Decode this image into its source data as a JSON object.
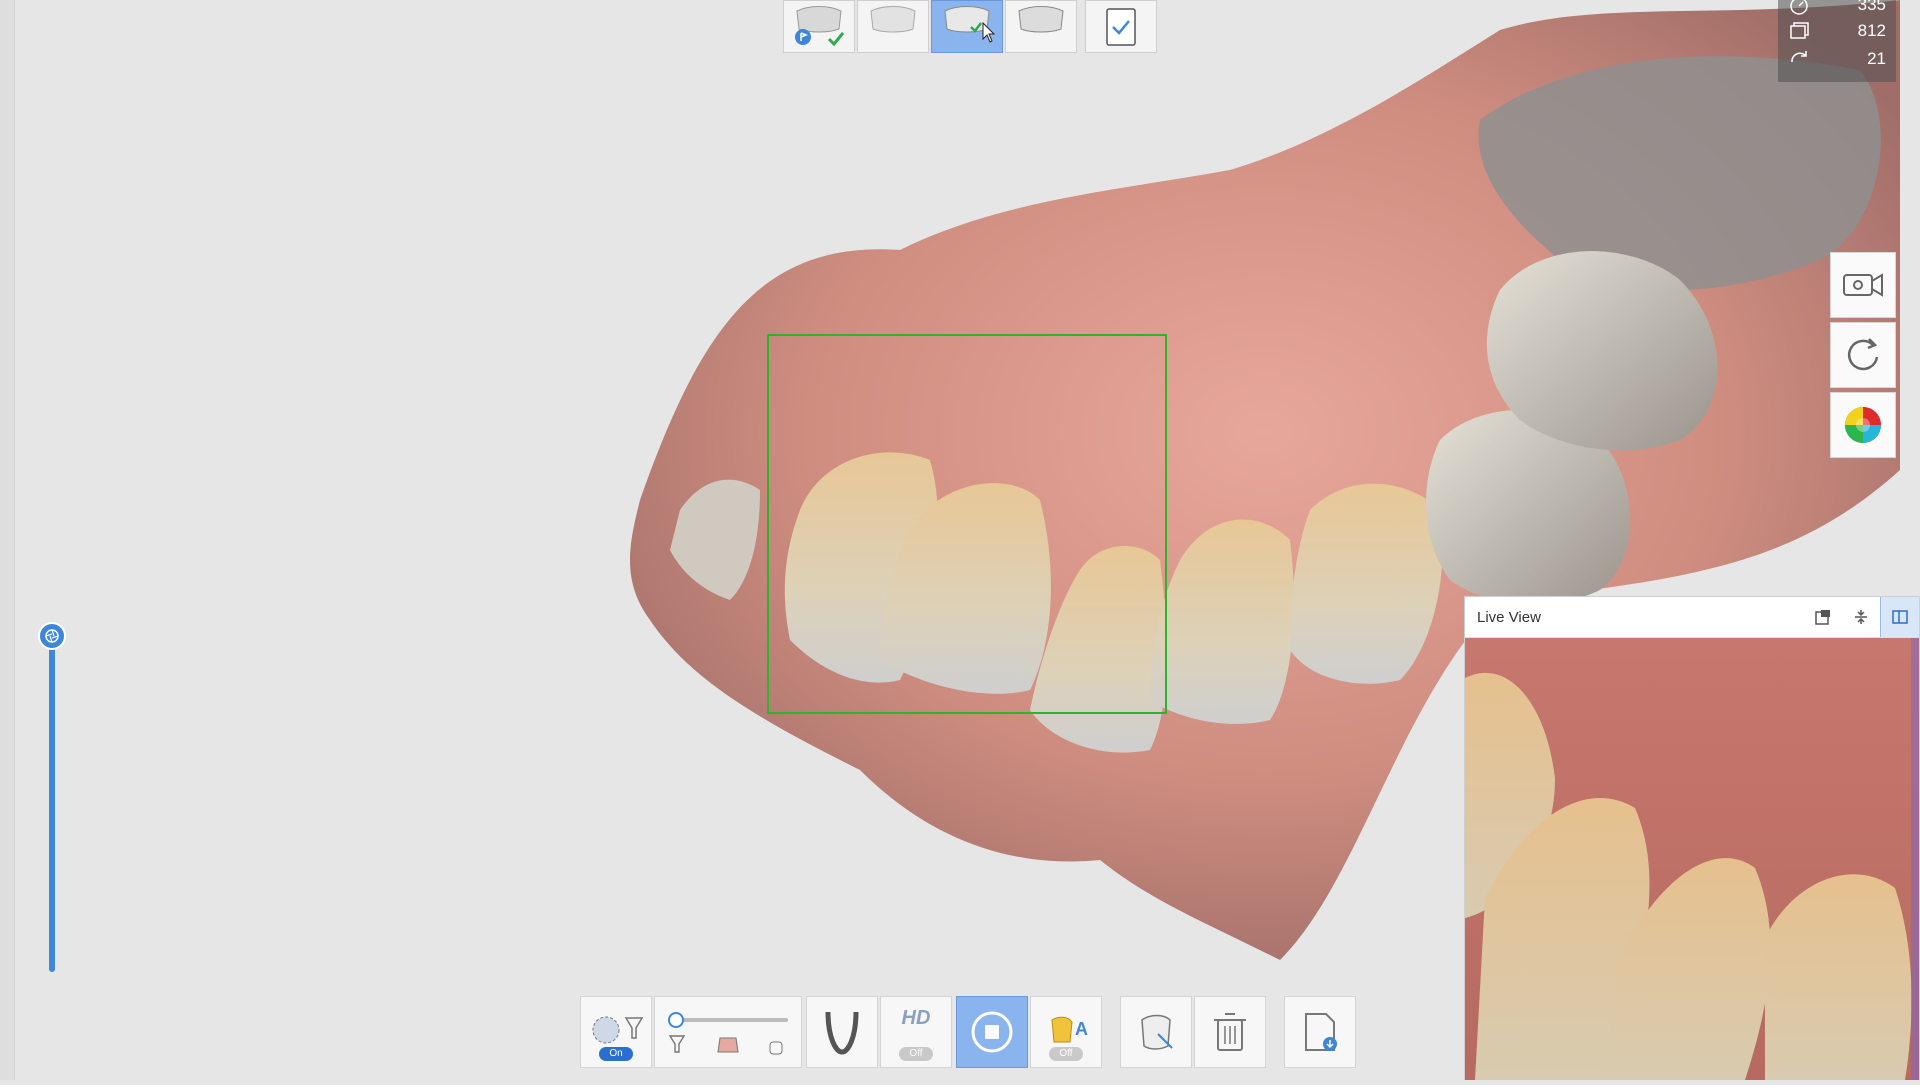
{
  "stats": [
    {
      "icon": "timer-icon",
      "value": "335"
    },
    {
      "icon": "frames-icon",
      "value": "812"
    },
    {
      "icon": "rotation-icon",
      "value": "21"
    }
  ],
  "live_view": {
    "title": "Live View"
  },
  "toolbar": {
    "hd_label": "HD",
    "ai_label": "A",
    "filter_toggle": "On",
    "hd_toggle": "Off",
    "ai_toggle": "Off"
  },
  "colors": {
    "accent": "#3d86d8",
    "active_step": "#8ab4ee",
    "scan_box": "#2bb52b",
    "check": "#2fa84f"
  }
}
